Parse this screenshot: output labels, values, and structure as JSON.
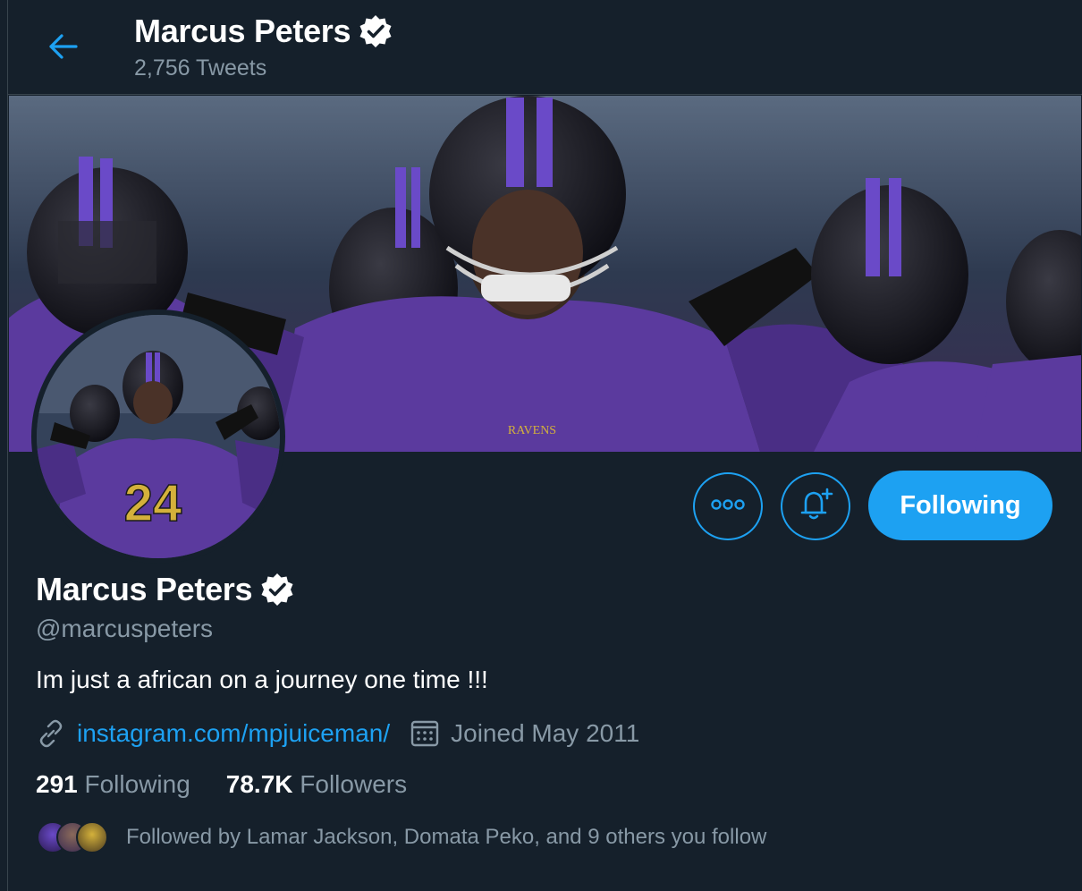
{
  "header": {
    "name": "Marcus Peters",
    "tweet_count": "2,756 Tweets"
  },
  "profile": {
    "name": "Marcus Peters",
    "handle": "@marcuspeters",
    "bio": "Im just a african on a journey one time !!!",
    "link": "instagram.com/mpjuiceman/",
    "joined": "Joined May 2011",
    "following_count": "291",
    "following_label": "Following",
    "followers_count": "78.7K",
    "followers_label": "Followers",
    "followed_by": "Followed by Lamar Jackson, Domata Peko, and 9 others you follow",
    "jersey_number": "24"
  },
  "actions": {
    "follow_button": "Following"
  },
  "colors": {
    "background": "#15202b",
    "accent": "#1da1f2",
    "secondary_text": "#8899a6",
    "border": "#38444d",
    "team_purple": "#5b3a9e"
  },
  "icons": [
    "back-arrow-icon",
    "verified-badge-icon",
    "more-options-icon",
    "bell-plus-icon",
    "link-icon",
    "calendar-icon"
  ]
}
